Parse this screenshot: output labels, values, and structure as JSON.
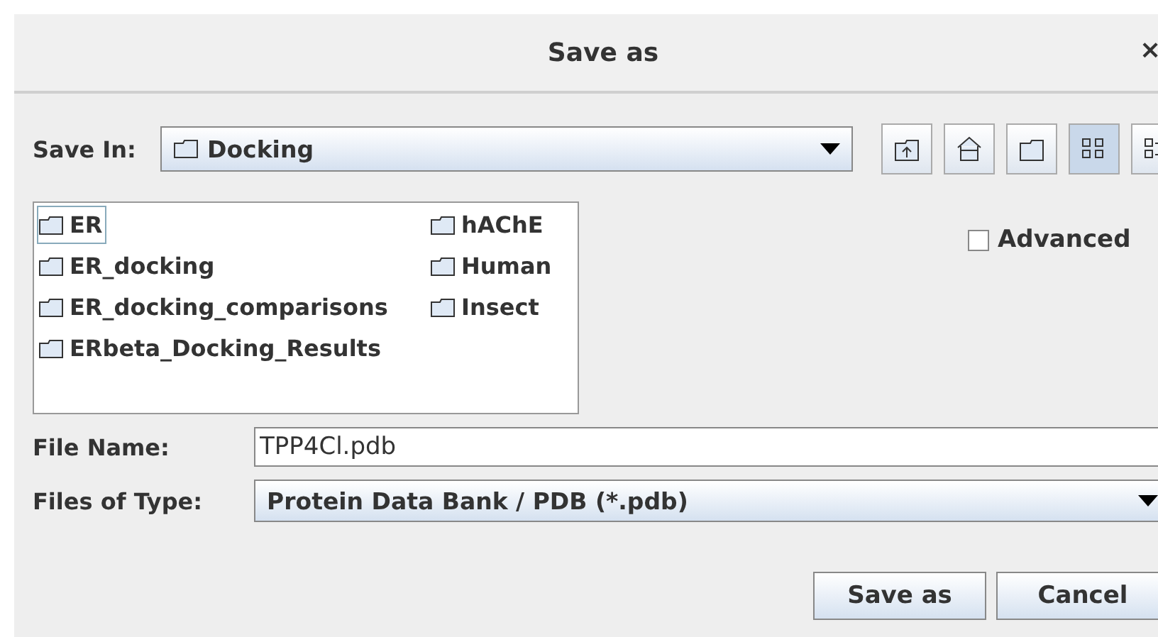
{
  "window": {
    "title": "Save as",
    "close": "×"
  },
  "save_in": {
    "label": "Save In:",
    "value": "Docking"
  },
  "toolbar": [
    {
      "kind": "up",
      "selected": false
    },
    {
      "kind": "home",
      "selected": false
    },
    {
      "kind": "new-folder",
      "selected": false
    },
    {
      "kind": "list",
      "selected": true
    },
    {
      "kind": "details",
      "selected": false
    }
  ],
  "files": [
    {
      "name": "ER",
      "selected": true
    },
    {
      "name": "ER_docking",
      "selected": false
    },
    {
      "name": "ER_docking_comparisons",
      "selected": false
    },
    {
      "name": "ERbeta_Docking_Results",
      "selected": false
    },
    {
      "name": "hAChE",
      "selected": false
    },
    {
      "name": "Human",
      "selected": false
    },
    {
      "name": "Insect",
      "selected": false
    }
  ],
  "advanced": {
    "label": "Advanced",
    "checked": false
  },
  "file_name": {
    "label": "File Name:",
    "value": "TPP4Cl.pdb"
  },
  "file_type": {
    "label": "Files of Type:",
    "value": "Protein Data Bank / PDB (*.pdb)"
  },
  "buttons": [
    "Save as",
    "Cancel"
  ]
}
